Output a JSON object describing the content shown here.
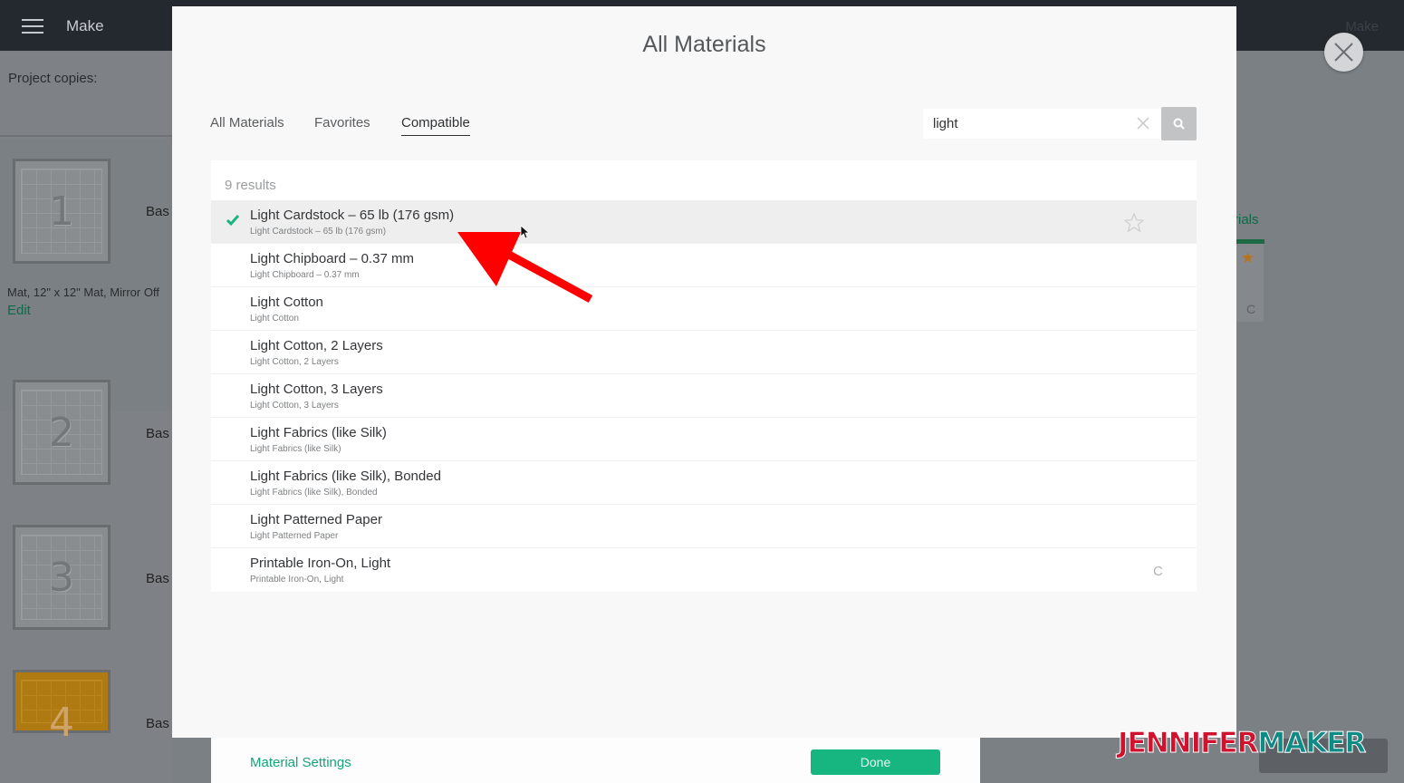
{
  "app": {
    "title": "Make",
    "top_right": "Make"
  },
  "left_panel": {
    "copies_label": "Project copies:",
    "mats": [
      {
        "number": "1",
        "label": "Bas",
        "info": "Mat, 12\" x 12\" Mat, Mirror Off",
        "edit": "Edit"
      },
      {
        "number": "2",
        "label": "Bas"
      },
      {
        "number": "3",
        "label": "Bas"
      },
      {
        "number": "4",
        "label": "Bas"
      }
    ]
  },
  "right_panel": {
    "fragment_text": "rials",
    "star": "★",
    "refresh": "C"
  },
  "modal": {
    "title": "All Materials",
    "tabs": [
      {
        "label": "All Materials",
        "active": false
      },
      {
        "label": "Favorites",
        "active": false
      },
      {
        "label": "Compatible",
        "active": true
      }
    ],
    "search": {
      "value": "light",
      "placeholder": "Search"
    },
    "results_count": "9 results",
    "results": [
      {
        "name": "Light Cardstock – 65 lb (176 gsm)",
        "sub": "Light Cardstock – 65 lb (176 gsm)",
        "selected": true
      },
      {
        "name": "Light Chipboard – 0.37 mm",
        "sub": "Light Chipboard – 0.37 mm"
      },
      {
        "name": "Light Cotton",
        "sub": "Light Cotton"
      },
      {
        "name": "Light Cotton, 2 Layers",
        "sub": "Light Cotton, 2 Layers"
      },
      {
        "name": "Light Cotton, 3 Layers",
        "sub": "Light Cotton, 3 Layers"
      },
      {
        "name": "Light Fabrics (like Silk)",
        "sub": "Light Fabrics (like Silk)"
      },
      {
        "name": "Light Fabrics (like Silk), Bonded",
        "sub": "Light Fabrics (like Silk), Bonded"
      },
      {
        "name": "Light Patterned Paper",
        "sub": "Light Patterned Paper"
      },
      {
        "name": "Printable Iron-On, Light",
        "sub": "Printable Iron-On, Light"
      }
    ],
    "refresh_glyph": "C"
  },
  "footer": {
    "material_settings": "Material Settings",
    "done": "Done"
  },
  "watermark": {
    "part1": "JENNIFER",
    "part2": "MAKER"
  },
  "colors": {
    "accent_green": "#17b57f",
    "check_green": "#17b57f",
    "annotation_red": "#ff0000"
  }
}
